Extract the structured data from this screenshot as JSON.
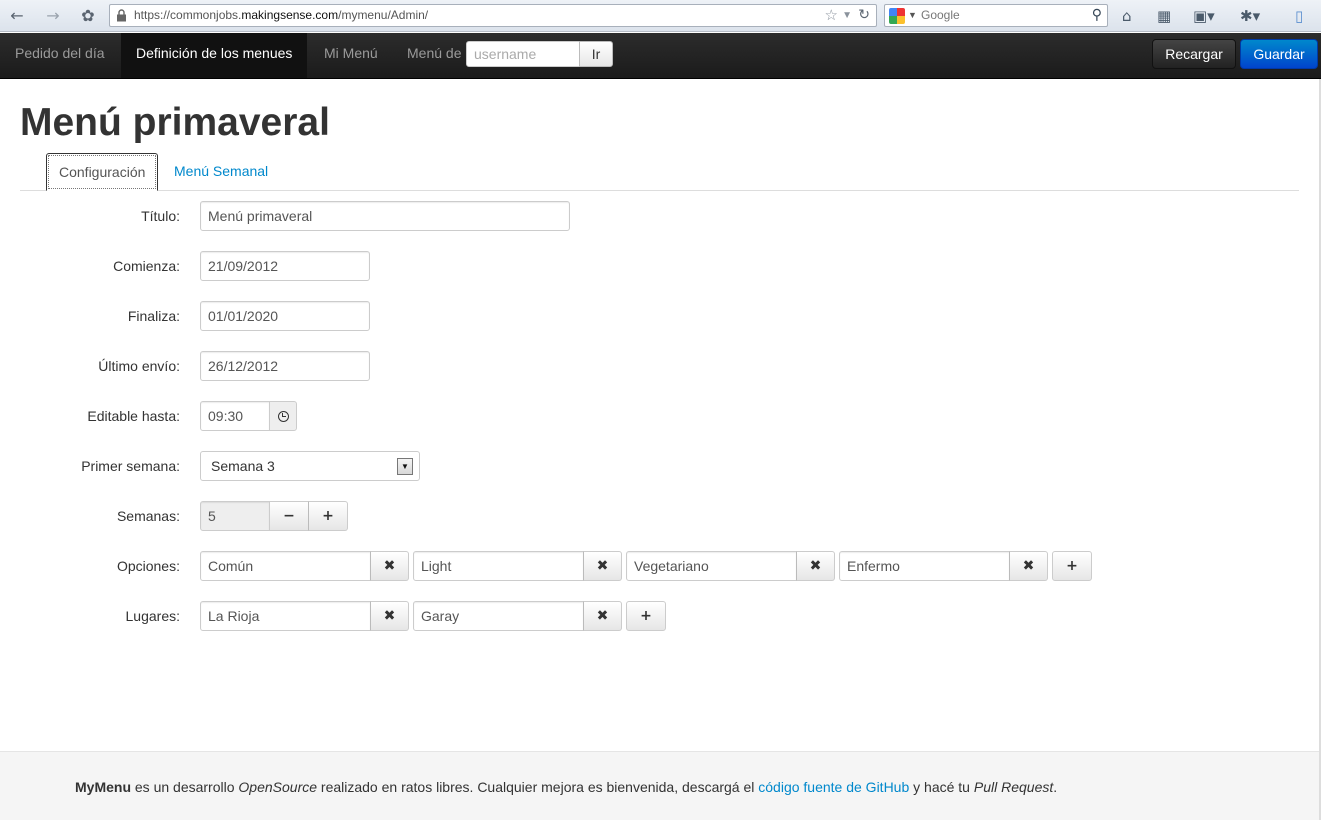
{
  "browser": {
    "url_prefix": "https://commonjobs.",
    "url_domain": "makingsense.com",
    "url_path": "/mymenu/Admin/",
    "search_placeholder": "Google"
  },
  "navbar": {
    "items": [
      {
        "label": "Pedido del día",
        "active": false
      },
      {
        "label": "Definición de los menues",
        "active": true
      },
      {
        "label": "Mi Menú",
        "active": false
      }
    ],
    "menu_de_label": "Menú de",
    "username_placeholder": "username",
    "ir_label": "Ir",
    "reload_label": "Recargar",
    "save_label": "Guardar"
  },
  "page": {
    "title": "Menú primaveral",
    "tabs": [
      {
        "label": "Configuración",
        "active": true
      },
      {
        "label": "Menú Semanal",
        "active": false
      }
    ]
  },
  "form": {
    "titulo": {
      "label": "Título:",
      "value": "Menú primaveral"
    },
    "comienza": {
      "label": "Comienza:",
      "value": "21/09/2012"
    },
    "finaliza": {
      "label": "Finaliza:",
      "value": "01/01/2020"
    },
    "ultimo_envio": {
      "label": "Último envío:",
      "value": "26/12/2012"
    },
    "editable_hasta": {
      "label": "Editable hasta:",
      "value": "09:30"
    },
    "primer_semana": {
      "label": "Primer semana:",
      "value": "Semana 3"
    },
    "semanas": {
      "label": "Semanas:",
      "value": "5"
    },
    "opciones": {
      "label": "Opciones:",
      "items": [
        "Común",
        "Light",
        "Vegetariano",
        "Enfermo"
      ]
    },
    "lugares": {
      "label": "Lugares:",
      "items": [
        "La Rioja",
        "Garay"
      ]
    }
  },
  "footer": {
    "brand": "MyMenu",
    "t1": " es un desarrollo ",
    "opensource": "OpenSource",
    "t2": " realizado en ratos libres. Cualquier mejora es bienvenida, descargá el ",
    "link": "código fuente de GitHub",
    "t3": " y hacé tu ",
    "pr": "Pull Request",
    "t4": "."
  }
}
